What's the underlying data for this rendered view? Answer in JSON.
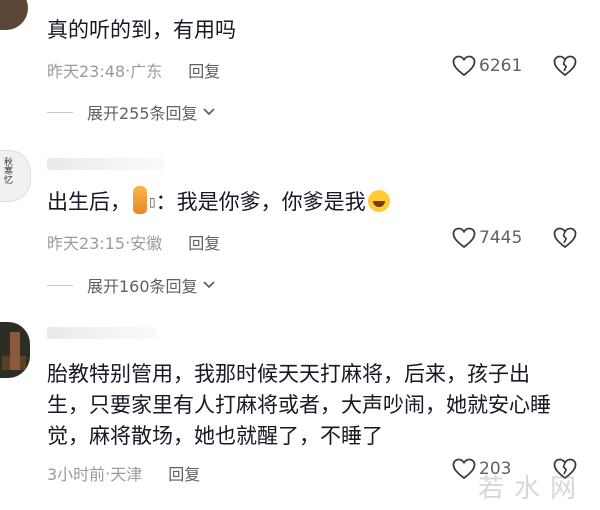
{
  "comments": [
    {
      "text": "真的听的到，有用吗",
      "time": "昨天23:48",
      "location": "广东",
      "reply": "回复",
      "likes": "6261",
      "expand": "展开255条回复"
    },
    {
      "text_before": "出生后，",
      "text_mid": "：我是你爹，你爹是我",
      "time": "昨天23:15",
      "location": "安徽",
      "reply": "回复",
      "likes": "7445",
      "expand": "展开160条回复"
    },
    {
      "lines": [
        "胎教特别管用，我那时候天天打麻将，后来，孩子出",
        "生，只要家里有人打麻将或者，大声吵闹，她就安心睡",
        "觉，麻将散场，她也就醒了，不睡了"
      ],
      "time": "3小时前",
      "location": "天津",
      "reply": "回复",
      "likes": "203"
    }
  ],
  "separator": " · ",
  "avatar2_mark": "秋\n寒\n忆",
  "watermark": "若水网",
  "icons": {
    "like": "heart-outline-icon",
    "dislike": "broken-heart-icon",
    "expand": "chevron-down-icon"
  },
  "colors": {
    "text": "#161823",
    "meta": "#9a9ba0",
    "action": "#5f6066"
  }
}
